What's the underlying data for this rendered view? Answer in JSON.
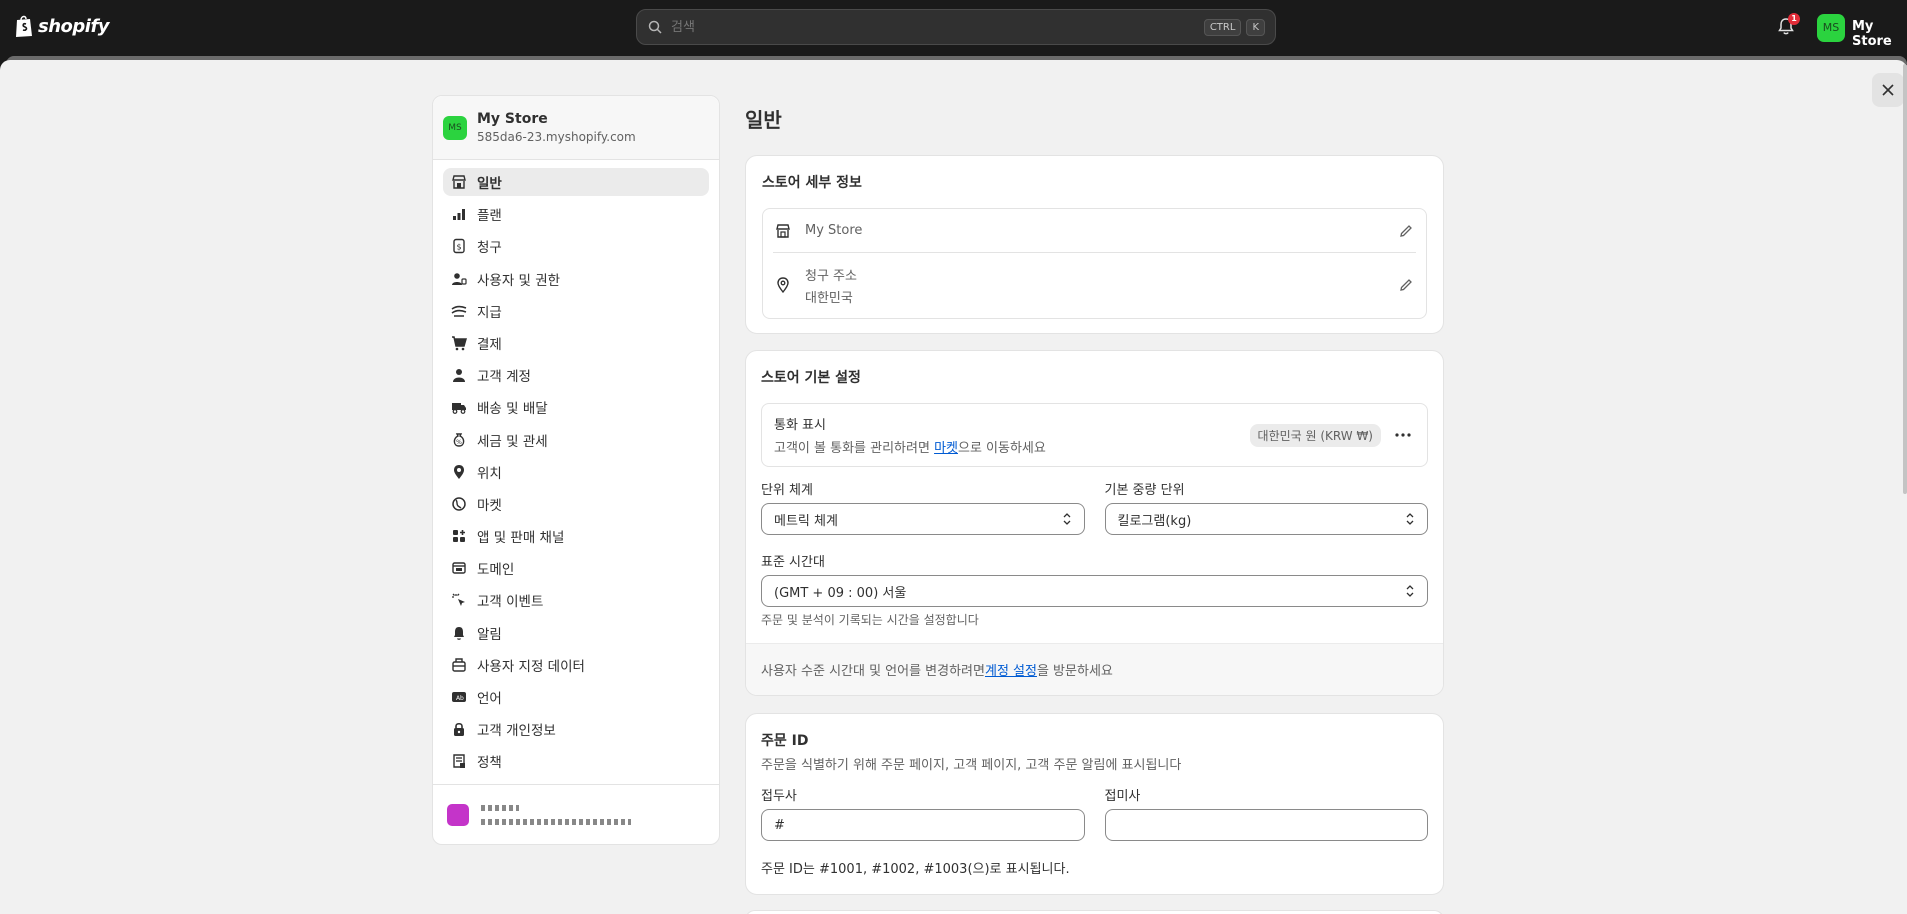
{
  "topbar": {
    "logo_text": "shopify",
    "search_placeholder": "검색",
    "kbd_ctrl": "CTRL",
    "kbd_k": "K",
    "notification_count": "1",
    "avatar_initials": "MS",
    "store_name": "My Store"
  },
  "sidebar": {
    "store_initials": "MS",
    "store_name": "My Store",
    "store_url": "585da6-23.myshopify.com",
    "items": [
      {
        "label": "일반",
        "icon": "store-icon"
      },
      {
        "label": "플랜",
        "icon": "plan-icon"
      },
      {
        "label": "청구",
        "icon": "billing-icon"
      },
      {
        "label": "사용자 및 권한",
        "icon": "users-icon"
      },
      {
        "label": "지급",
        "icon": "payments-icon"
      },
      {
        "label": "결제",
        "icon": "cart-icon"
      },
      {
        "label": "고객 계정",
        "icon": "person-icon"
      },
      {
        "label": "배송 및 배달",
        "icon": "truck-icon"
      },
      {
        "label": "세금 및 관세",
        "icon": "tax-icon"
      },
      {
        "label": "위치",
        "icon": "location-icon"
      },
      {
        "label": "마켓",
        "icon": "globe-icon"
      },
      {
        "label": "앱 및 판매 채널",
        "icon": "apps-icon"
      },
      {
        "label": "도메인",
        "icon": "domain-icon"
      },
      {
        "label": "고객 이벤트",
        "icon": "cursor-icon"
      },
      {
        "label": "알림",
        "icon": "bell-icon"
      },
      {
        "label": "사용자 지정 데이터",
        "icon": "database-icon"
      },
      {
        "label": "언어",
        "icon": "language-icon"
      },
      {
        "label": "고객 개인정보",
        "icon": "lock-icon"
      },
      {
        "label": "정책",
        "icon": "policy-icon"
      }
    ]
  },
  "main": {
    "title": "일반",
    "store_details": {
      "title": "스토어 세부 정보",
      "store_name": "My Store",
      "billing_label": "청구 주소",
      "billing_value": "대한민국"
    },
    "store_defaults": {
      "title": "스토어 기본 설정",
      "currency_label": "통화 표시",
      "currency_desc_pre": "고객이 볼 통화를 관리하려면 ",
      "currency_desc_link": "마켓",
      "currency_desc_post": "으로 이동하세요",
      "currency_value": "대한민국 원 (KRW ₩)",
      "unit_label": "단위 체계",
      "unit_value": "메트릭 체계",
      "weight_label": "기본 중량 단위",
      "weight_value": "킬로그램(kg)",
      "timezone_label": "표준 시간대",
      "timezone_value": "(GMT + 09 : 00) 서울",
      "timezone_help": "주문 및 분석이 기록되는 시간을 설정합니다",
      "footer_pre": "사용자 수준 시간대 및 언어를 변경하려면 ",
      "footer_link": "계정 설정",
      "footer_post": "을 방문하세요"
    },
    "order_id": {
      "title": "주문 ID",
      "desc": "주문을 식별하기 위해 주문 페이지, 고객 페이지, 고객 주문 알림에 표시됩니다",
      "prefix_label": "접두사",
      "prefix_value": "#",
      "suffix_label": "접미사",
      "suffix_value": "",
      "help": "주문 ID는 #1001, #1002, #1003(으)로 표시됩니다."
    }
  },
  "colors": {
    "topbar_bg": "#1a1a1a",
    "page_bg": "#f1f1f1",
    "avatar_green": "#2bd33f",
    "link_blue": "#005bd3",
    "badge_red": "#e22c38"
  }
}
